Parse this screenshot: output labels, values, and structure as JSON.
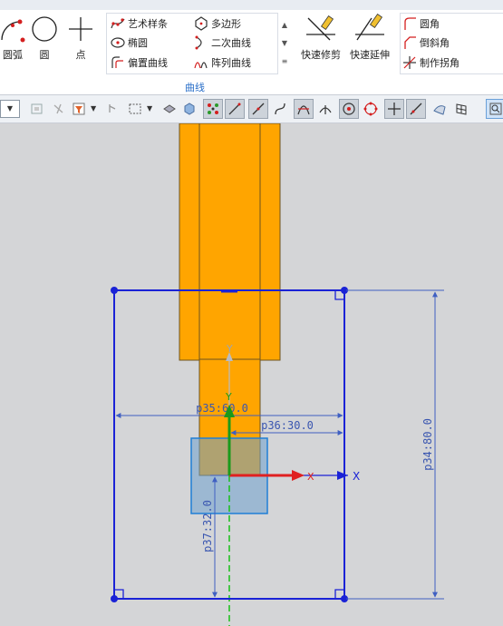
{
  "ribbon": {
    "left_tools": [
      {
        "label": "圆弧",
        "icon": "arc-icon"
      },
      {
        "label": "圆",
        "icon": "circle-icon"
      },
      {
        "label": "点",
        "icon": "point-icon"
      }
    ],
    "curve_group": {
      "label": "曲线",
      "col1": [
        {
          "label": "艺术样条",
          "icon": "spline-icon"
        },
        {
          "label": "椭圆",
          "icon": "ellipse-icon"
        },
        {
          "label": "偏置曲线",
          "icon": "offset-curve-icon"
        }
      ],
      "col2": [
        {
          "label": "多边形",
          "icon": "polygon-icon"
        },
        {
          "label": "二次曲线",
          "icon": "conic-icon"
        },
        {
          "label": "阵列曲线",
          "icon": "pattern-curve-icon"
        }
      ]
    },
    "edit_tools": [
      {
        "label": "快速修剪",
        "icon": "quick-trim-icon"
      },
      {
        "label": "快速延伸",
        "icon": "quick-extend-icon"
      }
    ],
    "corner_tools": [
      {
        "label": "圆角",
        "icon": "fillet-icon"
      },
      {
        "label": "倒斜角",
        "icon": "chamfer-icon"
      },
      {
        "label": "制作拐角",
        "icon": "make-corner-icon"
      }
    ]
  },
  "sketch": {
    "dimensions": {
      "width_label": "p35:60.0",
      "offset_x_label": "p36:30.0",
      "height_label": "p34:80.0",
      "offset_y_label": "p37:32.0"
    },
    "axes": {
      "x_label": "X",
      "y_label": "Y"
    },
    "colors": {
      "part": "#ffa500",
      "part_edge": "#6d5420",
      "sketch_line": "#1a22d6",
      "dim_line": "#3f5fc2",
      "x_axis": "#e02020",
      "y_axis": "#1a9a1a",
      "center_line": "#16c016"
    }
  }
}
